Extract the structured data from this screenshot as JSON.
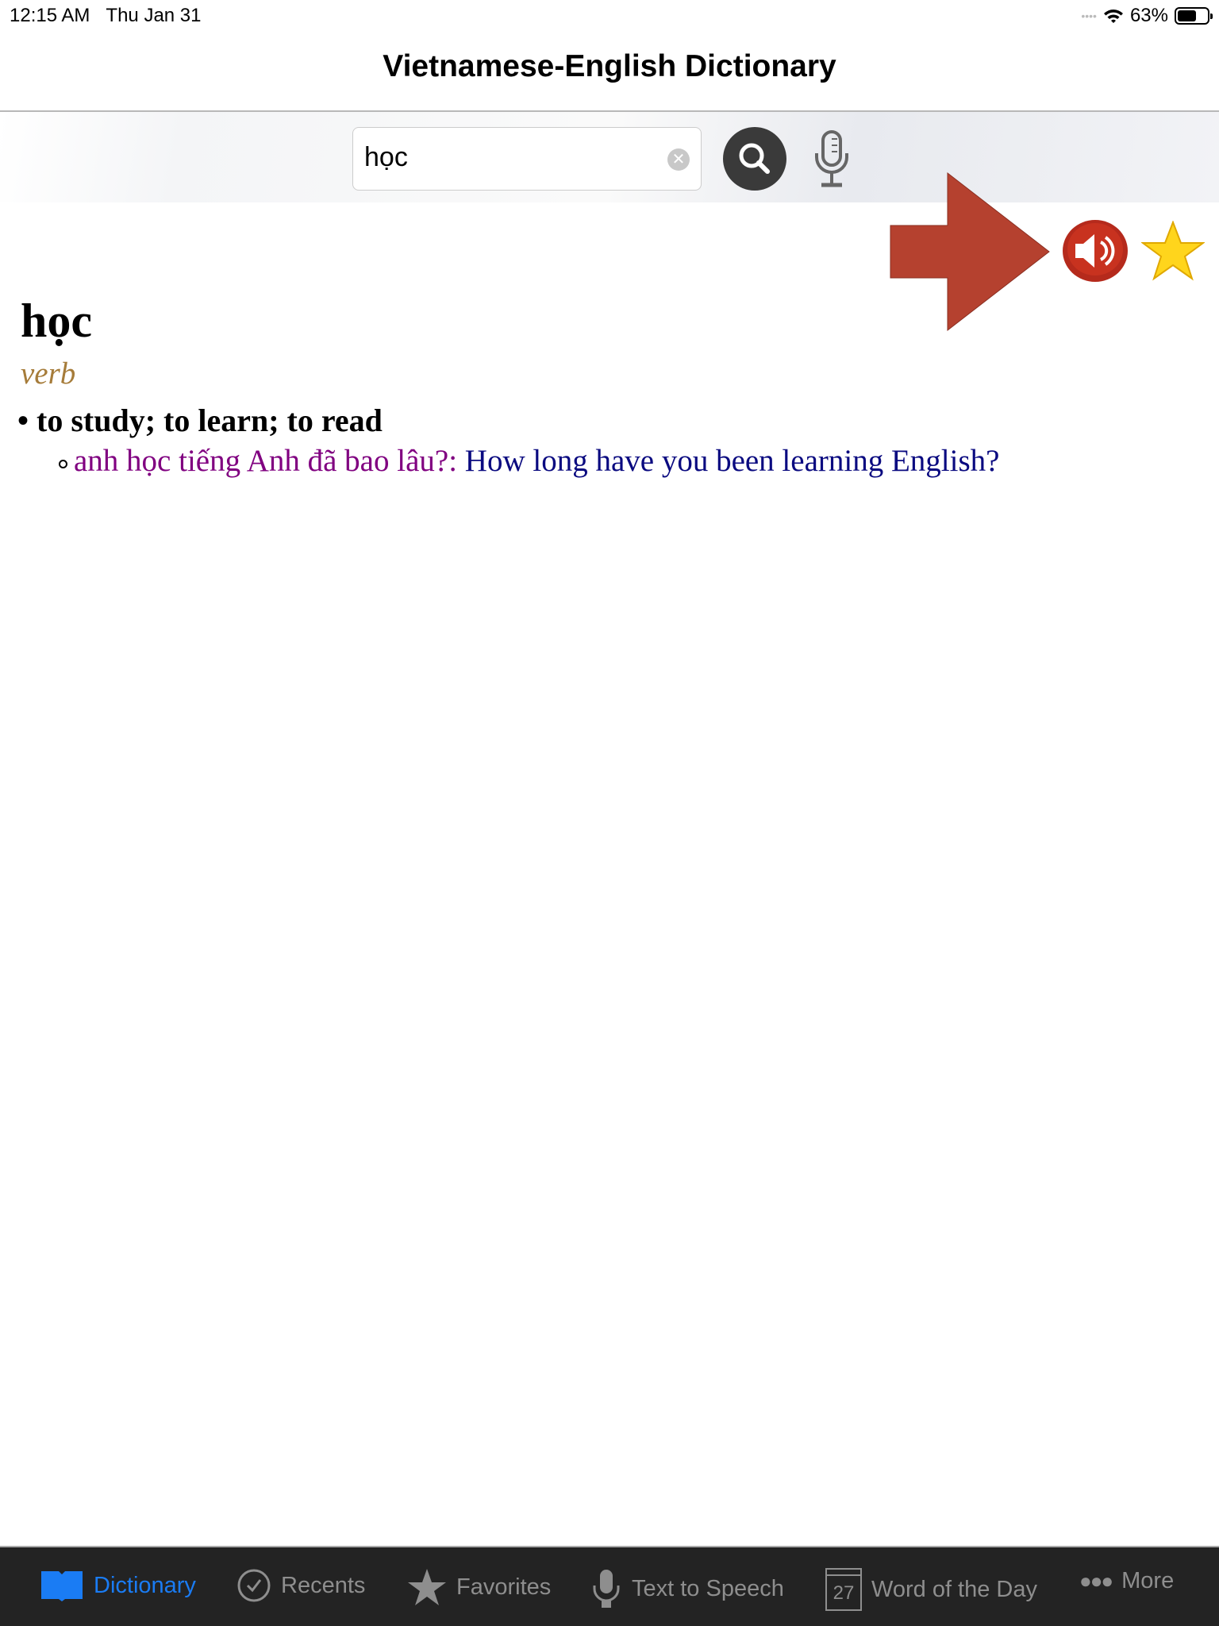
{
  "status": {
    "time": "12:15 AM",
    "date": "Thu Jan 31",
    "battery": "63%",
    "battery_level": 0.63
  },
  "header": {
    "title": "Vietnamese-English Dictionary"
  },
  "search": {
    "value": "học",
    "placeholder": ""
  },
  "entry": {
    "headword": "học",
    "part_of_speech": "verb",
    "definition": "to study; to learn; to read",
    "example_vi": "anh học tiếng Anh đã bao lâu?:",
    "example_en": "How long have you been learning English?"
  },
  "colors": {
    "accent": "#1a7cf4",
    "arrow": "#b5412f",
    "pos": "#a67c3a",
    "example_vi": "#800080",
    "example_en": "#0a0a80"
  },
  "tabs": [
    {
      "label": "Dictionary",
      "icon": "book-icon",
      "active": true
    },
    {
      "label": "Recents",
      "icon": "clock-check-icon"
    },
    {
      "label": "Favorites",
      "icon": "star-icon"
    },
    {
      "label": "Text to Speech",
      "icon": "microphone-icon"
    },
    {
      "label": "Word of the Day",
      "icon": "calendar-icon",
      "calendar_day": "27"
    },
    {
      "label": "More",
      "icon": "more-dots-icon"
    }
  ]
}
